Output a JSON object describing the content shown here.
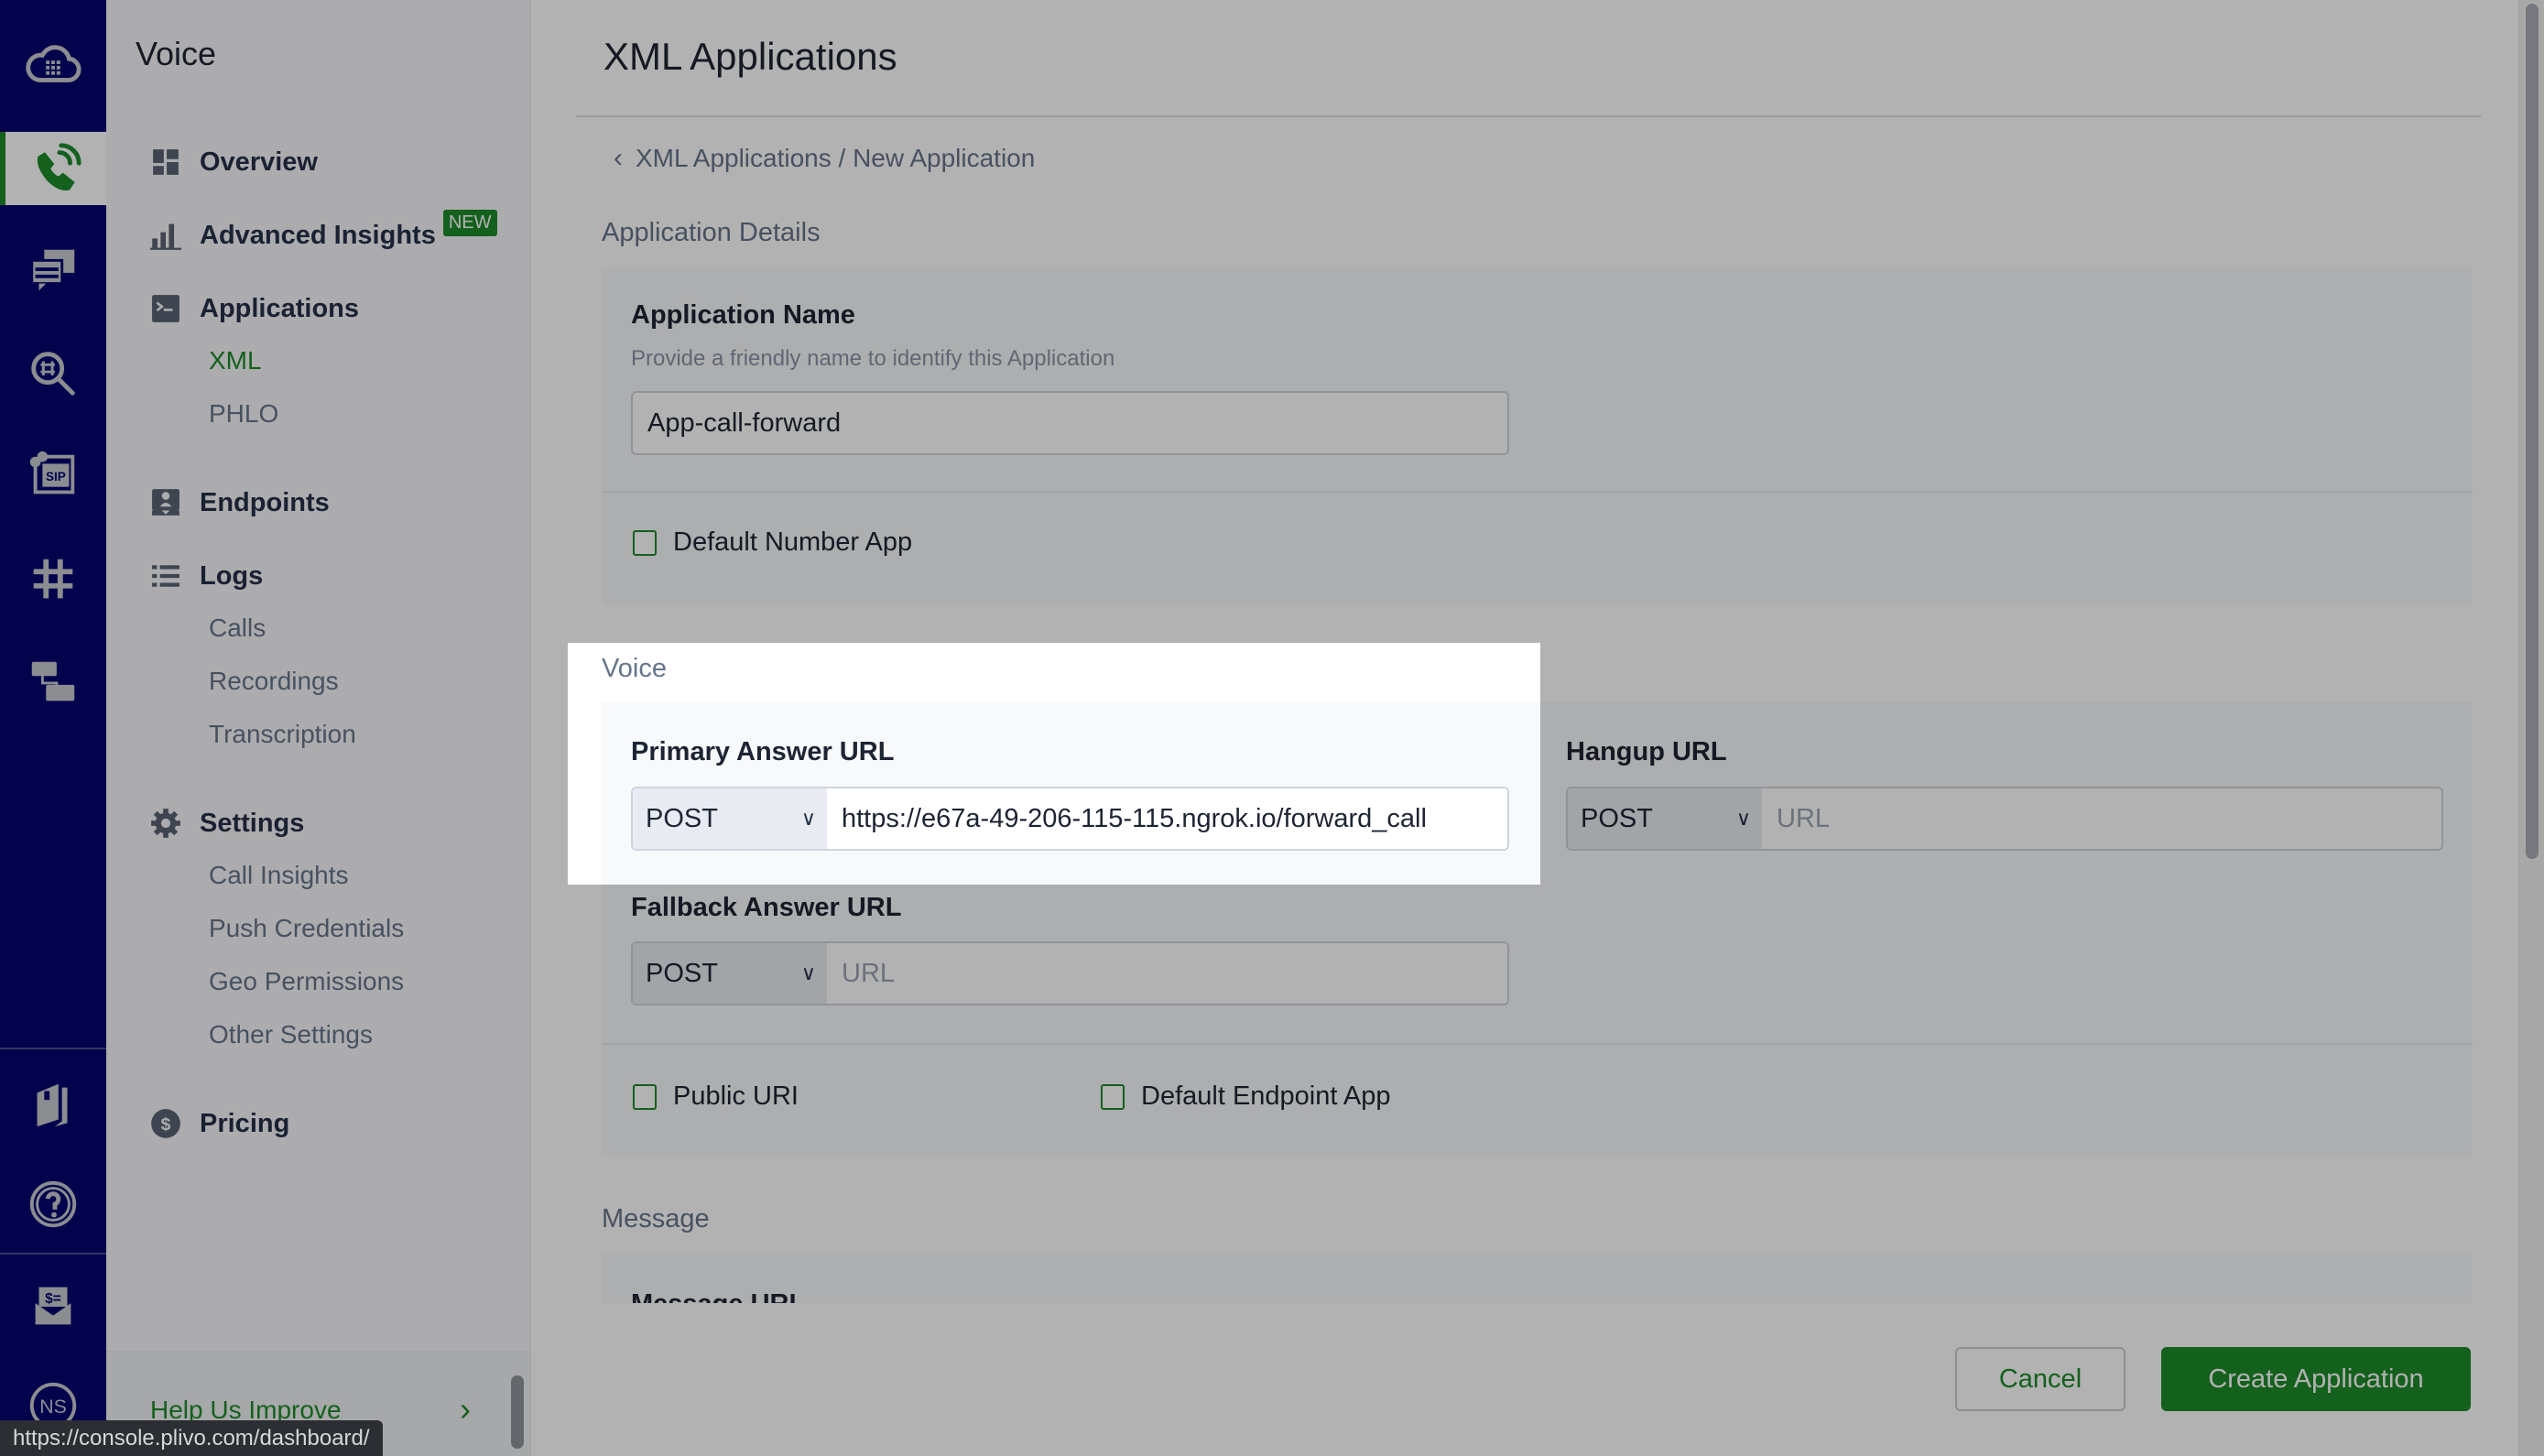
{
  "rail": {
    "icons": [
      {
        "name": "cloud-keypad-logo-icon",
        "active": false
      },
      {
        "name": "voice-call-icon",
        "active": true
      },
      {
        "name": "messaging-icon",
        "active": false
      },
      {
        "name": "number-lookup-icon",
        "active": false
      },
      {
        "name": "sip-trunking-icon",
        "active": false
      },
      {
        "name": "phone-numbers-icon",
        "active": false
      },
      {
        "name": "phlo-flow-icon",
        "active": false
      },
      {
        "name": "docs-book-icon",
        "active": false
      },
      {
        "name": "help-icon",
        "active": false
      },
      {
        "name": "billing-icon",
        "active": false
      },
      {
        "name": "account-avatar-icon",
        "active": false
      }
    ],
    "avatar_initials": "NS",
    "sip_text": "SIP"
  },
  "sidebar": {
    "title": "Voice",
    "items": [
      {
        "label": "Overview",
        "icon": "dashboard-icon"
      },
      {
        "label": "Advanced Insights",
        "icon": "bar-chart-icon",
        "badge": "NEW"
      },
      {
        "label": "Applications",
        "icon": "terminal-icon",
        "children": [
          {
            "label": "XML",
            "active": true
          },
          {
            "label": "PHLO",
            "active": false
          }
        ]
      },
      {
        "label": "Endpoints",
        "icon": "endpoint-icon"
      },
      {
        "label": "Logs",
        "icon": "list-icon",
        "children": [
          {
            "label": "Calls"
          },
          {
            "label": "Recordings"
          },
          {
            "label": "Transcription"
          }
        ]
      },
      {
        "label": "Settings",
        "icon": "gear-icon",
        "children": [
          {
            "label": "Call Insights"
          },
          {
            "label": "Push Credentials"
          },
          {
            "label": "Geo Permissions"
          },
          {
            "label": "Other Settings"
          }
        ]
      },
      {
        "label": "Pricing",
        "icon": "dollar-circle-icon"
      }
    ],
    "help": "Help Us Improve"
  },
  "main": {
    "title": "XML Applications",
    "breadcrumb": "XML Applications / New Application",
    "app_details": {
      "section_label": "Application Details",
      "name_label": "Application Name",
      "name_hint": "Provide a friendly name to identify this Application",
      "name_value": "App-call-forward",
      "default_number_app": {
        "label": "Default Number App",
        "checked": false
      }
    },
    "voice": {
      "section_label": "Voice",
      "primary": {
        "label": "Primary Answer URL",
        "method": "POST",
        "value": "https://e67a-49-206-115-115.ngrok.io/forward_call",
        "placeholder": "URL"
      },
      "hangup": {
        "label": "Hangup URL",
        "method": "POST",
        "value": "",
        "placeholder": "URL"
      },
      "fallback": {
        "label": "Fallback Answer URL",
        "method": "POST",
        "value": "",
        "placeholder": "URL"
      },
      "public_uri": {
        "label": "Public URI",
        "checked": false
      },
      "default_endpoint_app": {
        "label": "Default Endpoint App",
        "checked": false
      }
    },
    "message": {
      "section_label": "Message",
      "url_label": "Message URL"
    },
    "footer": {
      "cancel": "Cancel",
      "create": "Create Application"
    }
  },
  "status_tooltip": "https://console.plivo.com/dashboard/",
  "colors": {
    "brand_green": "#1d8a2a",
    "rail_navy": "#05056f"
  }
}
